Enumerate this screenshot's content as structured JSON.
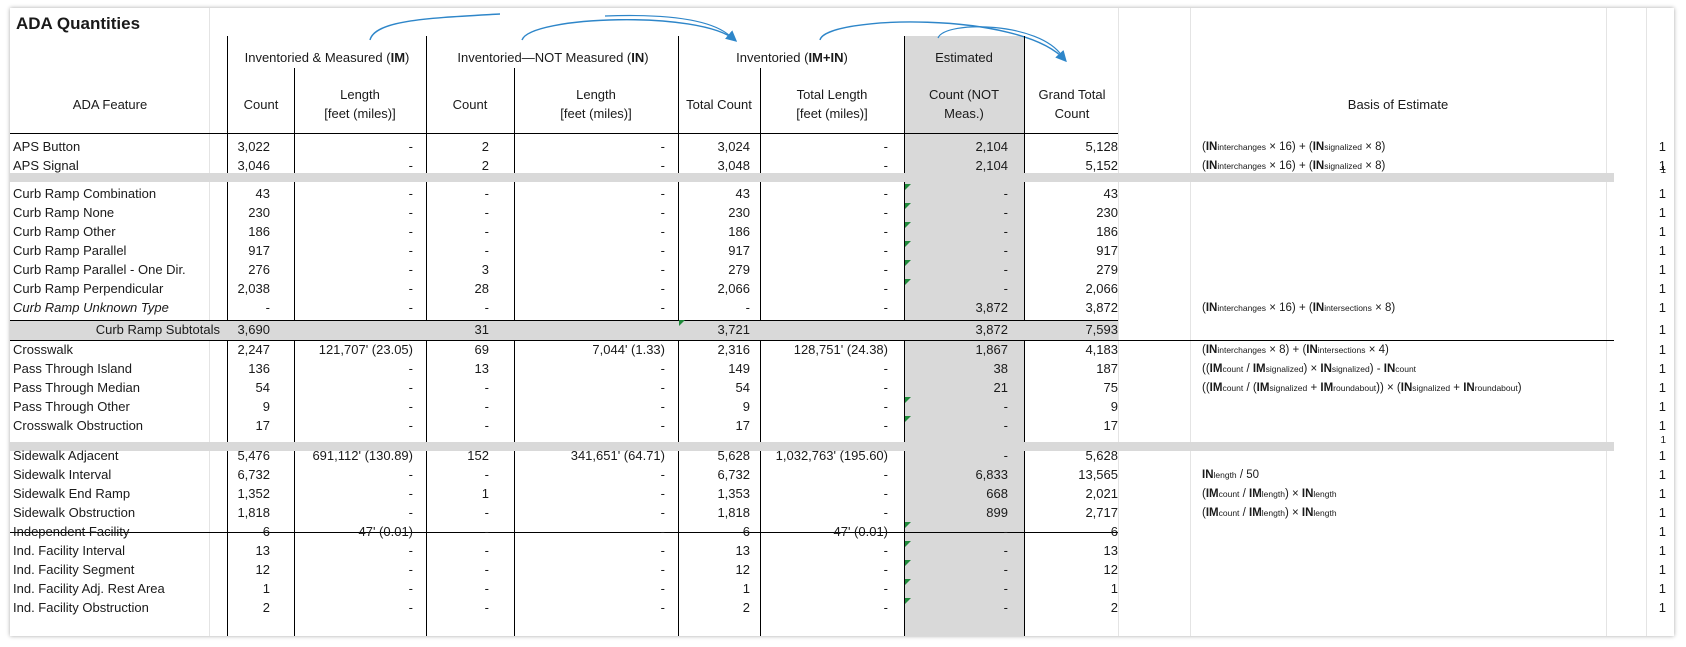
{
  "title": "ADA Quantities",
  "groups": {
    "im_prefix": "Inventoried & Measured (",
    "im_code": "IM",
    "im_suffix": ")",
    "in_prefix": "Inventoried—NOT Measured (",
    "in_code": "IN",
    "in_suffix": ")",
    "inv_prefix": "Inventoried (",
    "inv_code": "IM+IN",
    "inv_suffix": ")",
    "estimated": "Estimated"
  },
  "headers": {
    "feature": "ADA Feature",
    "im_count": "Count",
    "im_length_1": "Length",
    "im_length_2": "[feet (miles)]",
    "in_count": "Count",
    "in_length_1": "Length",
    "in_length_2": "[feet (miles)]",
    "total_count": "Total Count",
    "total_length_1": "Total Length",
    "total_length_2": "[feet (miles)]",
    "est_count_1": "Count (NOT",
    "est_count_2": "Meas.)",
    "grand_1": "Grand Total",
    "grand_2": "Count",
    "basis": "Basis of Estimate"
  },
  "rows": [
    {
      "feature": "APS Button",
      "im_count": "3,022",
      "im_length": "-",
      "in_count": "2",
      "in_length": "-",
      "total_count": "3,024",
      "total_length": "-",
      "est": "2,104",
      "grand": "5,128",
      "basis_html": "(<b>IN</b><small>interchanges</small> × 16) + (<b>IN</b><small>signalized</small> × 8)",
      "col_k": "1"
    },
    {
      "feature": "APS Signal",
      "im_count": "3,046",
      "im_length": "-",
      "in_count": "2",
      "in_length": "-",
      "total_count": "3,048",
      "total_length": "-",
      "est": "2,104",
      "grand": "5,152",
      "basis_html": "(<b>IN</b><small>interchanges</small> × 16) + (<b>IN</b><small>signalized</small> × 8)",
      "col_k": "1"
    },
    {
      "feature": "Curb Ramp Combination",
      "im_count": "43",
      "im_length": "-",
      "in_count": "-",
      "in_length": "-",
      "total_count": "43",
      "total_length": "-",
      "est": "-",
      "grand": "43",
      "basis_html": "",
      "col_k": "1"
    },
    {
      "feature": "Curb Ramp None",
      "im_count": "230",
      "im_length": "-",
      "in_count": "-",
      "in_length": "-",
      "total_count": "230",
      "total_length": "-",
      "est": "-",
      "grand": "230",
      "basis_html": "",
      "col_k": "1"
    },
    {
      "feature": "Curb Ramp Other",
      "im_count": "186",
      "im_length": "-",
      "in_count": "-",
      "in_length": "-",
      "total_count": "186",
      "total_length": "-",
      "est": "-",
      "grand": "186",
      "basis_html": "",
      "col_k": "1"
    },
    {
      "feature": "Curb Ramp Parallel",
      "im_count": "917",
      "im_length": "-",
      "in_count": "-",
      "in_length": "-",
      "total_count": "917",
      "total_length": "-",
      "est": "-",
      "grand": "917",
      "basis_html": "",
      "col_k": "1"
    },
    {
      "feature": "Curb Ramp Parallel - One Dir.",
      "im_count": "276",
      "im_length": "-",
      "in_count": "3",
      "in_length": "-",
      "total_count": "279",
      "total_length": "-",
      "est": "-",
      "grand": "279",
      "basis_html": "",
      "col_k": "1"
    },
    {
      "feature": "Curb Ramp Perpendicular",
      "im_count": "2,038",
      "im_length": "-",
      "in_count": "28",
      "in_length": "-",
      "total_count": "2,066",
      "total_length": "-",
      "est": "-",
      "grand": "2,066",
      "basis_html": "",
      "col_k": "1"
    },
    {
      "feature": "Curb Ramp Unknown Type",
      "im_count": "-",
      "im_length": "-",
      "in_count": "-",
      "in_length": "-",
      "total_count": "-",
      "total_length": "-",
      "est": "3,872",
      "grand": "3,872",
      "basis_html": "(<b>IN</b><small>interchanges</small> × 16) + (<b>IN</b><small>intersections</small> × 8)",
      "col_k": "1"
    },
    {
      "feature": "Curb Ramp Subtotals",
      "im_count": "3,690",
      "im_length": "",
      "in_count": "31",
      "in_length": "",
      "total_count": "3,721",
      "total_length": "",
      "est": "3,872",
      "grand": "7,593",
      "basis_html": "",
      "col_k": "1"
    },
    {
      "feature": "Crosswalk",
      "im_count": "2,247",
      "im_length": "121,707' (23.05)",
      "in_count": "69",
      "in_length": "7,044' (1.33)",
      "total_count": "2,316",
      "total_length": "128,751' (24.38)",
      "est": "1,867",
      "grand": "4,183",
      "basis_html": "(<b>IN</b><small>interchanges</small> × 8) + (<b>IN</b><small>intersections</small> × 4)",
      "col_k": "1"
    },
    {
      "feature": "Pass Through Island",
      "im_count": "136",
      "im_length": "-",
      "in_count": "13",
      "in_length": "-",
      "total_count": "149",
      "total_length": "-",
      "est": "38",
      "grand": "187",
      "basis_html": "((<b>IM</b><small>count</small> / <b>IM</b><small>signalized</small>) × <b>IN</b><small>signalized</small>) - <b>IN</b><small>count</small>",
      "col_k": "1"
    },
    {
      "feature": "Pass Through Median",
      "im_count": "54",
      "im_length": "-",
      "in_count": "-",
      "in_length": "-",
      "total_count": "54",
      "total_length": "-",
      "est": "21",
      "grand": "75",
      "basis_html": "((<b>IM</b><small>count</small> / (<b>IM</b><small>signalized</small> + <b>IM</b><small>roundabout</small>)) × (<b>IN</b><small>signalized</small> + <b>IN</b><small>roundabout</small>)",
      "col_k": "1"
    },
    {
      "feature": "Pass Through Other",
      "im_count": "9",
      "im_length": "-",
      "in_count": "-",
      "in_length": "-",
      "total_count": "9",
      "total_length": "-",
      "est": "-",
      "grand": "9",
      "basis_html": "",
      "col_k": "1"
    },
    {
      "feature": "Crosswalk Obstruction",
      "im_count": "17",
      "im_length": "-",
      "in_count": "-",
      "in_length": "-",
      "total_count": "17",
      "total_length": "-",
      "est": "-",
      "grand": "17",
      "basis_html": "",
      "col_k": "1"
    },
    {
      "feature": "Sidewalk Adjacent",
      "im_count": "5,476",
      "im_length": "691,112' (130.89)",
      "in_count": "152",
      "in_length": "341,651' (64.71)",
      "total_count": "5,628",
      "total_length": "1,032,763' (195.60)",
      "est": "-",
      "grand": "5,628",
      "basis_html": "",
      "col_k": "1"
    },
    {
      "feature": "Sidewalk Interval",
      "im_count": "6,732",
      "im_length": "-",
      "in_count": "-",
      "in_length": "-",
      "total_count": "6,732",
      "total_length": "-",
      "est": "6,833",
      "grand": "13,565",
      "basis_html": "<b>IN</b><small>length</small> / 50",
      "col_k": "1"
    },
    {
      "feature": "Sidewalk End Ramp",
      "im_count": "1,352",
      "im_length": "-",
      "in_count": "1",
      "in_length": "-",
      "total_count": "1,353",
      "total_length": "-",
      "est": "668",
      "grand": "2,021",
      "basis_html": "(<b>IM</b><small>count</small> / <b>IM</b><small>length</small>) × <b>IN</b><small>length</small>",
      "col_k": "1"
    },
    {
      "feature": "Sidewalk Obstruction",
      "im_count": "1,818",
      "im_length": "-",
      "in_count": "-",
      "in_length": "-",
      "total_count": "1,818",
      "total_length": "-",
      "est": "899",
      "grand": "2,717",
      "basis_html": "(<b>IM</b><small>count</small> / <b>IM</b><small>length</small>) × <b>IN</b><small>length</small>",
      "col_k": "1"
    },
    {
      "feature": "Independent Facility",
      "im_count": "6",
      "im_length": "47' (0.01)",
      "in_count": "-",
      "in_length": "-",
      "total_count": "6",
      "total_length": "47' (0.01)",
      "est": "-",
      "grand": "6",
      "basis_html": "",
      "col_k": "1"
    },
    {
      "feature": "Ind. Facility Interval",
      "im_count": "13",
      "im_length": "-",
      "in_count": "-",
      "in_length": "-",
      "total_count": "13",
      "total_length": "-",
      "est": "-",
      "grand": "13",
      "basis_html": "",
      "col_k": "1"
    },
    {
      "feature": "Ind. Facility Segment",
      "im_count": "12",
      "im_length": "-",
      "in_count": "-",
      "in_length": "-",
      "total_count": "12",
      "total_length": "-",
      "est": "-",
      "grand": "12",
      "basis_html": "",
      "col_k": "1"
    },
    {
      "feature": "Ind. Facility Adj. Rest Area",
      "im_count": "1",
      "im_length": "-",
      "in_count": "-",
      "in_length": "-",
      "total_count": "1",
      "total_length": "-",
      "est": "-",
      "grand": "1",
      "basis_html": "",
      "col_k": "1"
    },
    {
      "feature": "Ind. Facility Obstruction",
      "im_count": "2",
      "im_length": "-",
      "in_count": "-",
      "in_length": "-",
      "total_count": "2",
      "total_length": "-",
      "est": "-",
      "grand": "2",
      "basis_html": "",
      "col_k": "1"
    }
  ],
  "separator_values": {
    "col_k": "1"
  },
  "colors": {
    "shade": "#d9d9d9",
    "arrow": "#2e86c9",
    "comment_marker": "#1f8a3a"
  }
}
